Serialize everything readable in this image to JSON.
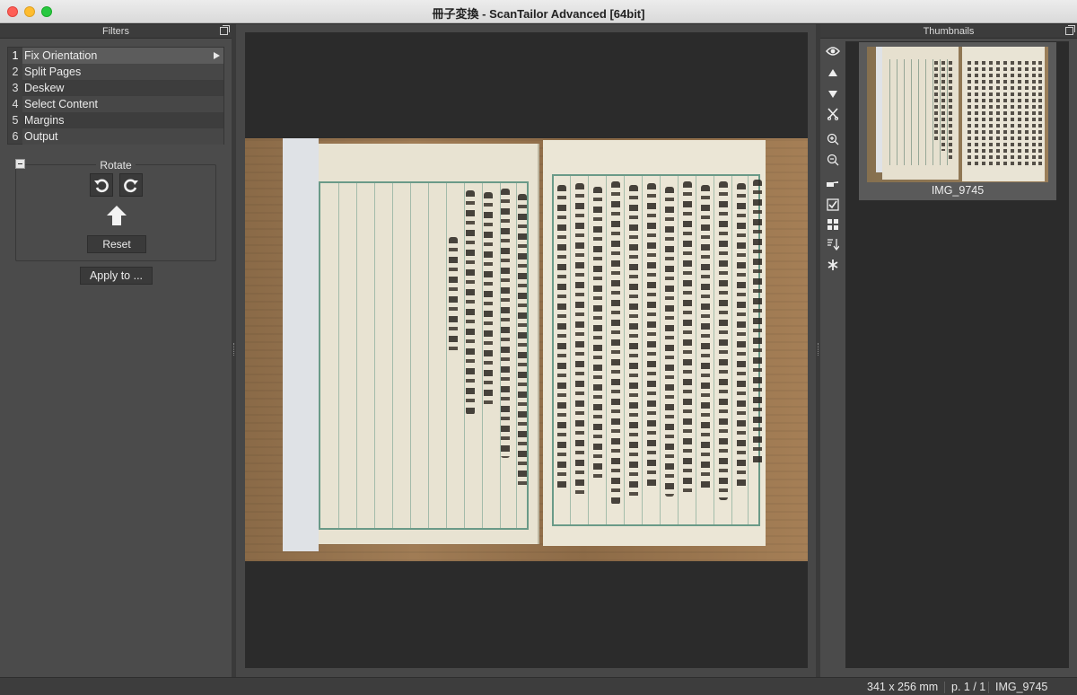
{
  "window": {
    "title": "冊子変換 - ScanTailor Advanced [64bit]"
  },
  "filters_panel": {
    "title": "Filters",
    "steps": [
      {
        "num": "1",
        "label": "Fix Orientation"
      },
      {
        "num": "2",
        "label": "Split Pages"
      },
      {
        "num": "3",
        "label": "Deskew"
      },
      {
        "num": "4",
        "label": "Select Content"
      },
      {
        "num": "5",
        "label": "Margins"
      },
      {
        "num": "6",
        "label": "Output"
      }
    ],
    "active_step": "1"
  },
  "rotate": {
    "title": "Rotate",
    "reset_label": "Reset",
    "apply_label": "Apply to ..."
  },
  "thumbnails_panel": {
    "title": "Thumbnails",
    "toolbar_icons": [
      "eye-icon",
      "triangle-up-icon",
      "triangle-down-icon",
      "scissors-icon",
      "zoom-in-icon",
      "zoom-out-icon",
      "hand-pointer-icon",
      "checkbox-icon",
      "grid-icon",
      "sort-icon",
      "asterisk-icon"
    ],
    "items": [
      {
        "label": "IMG_9745"
      }
    ]
  },
  "status": {
    "size": "341 x 256 mm",
    "page": "p. 1 / 1",
    "filename": "IMG_9745"
  }
}
